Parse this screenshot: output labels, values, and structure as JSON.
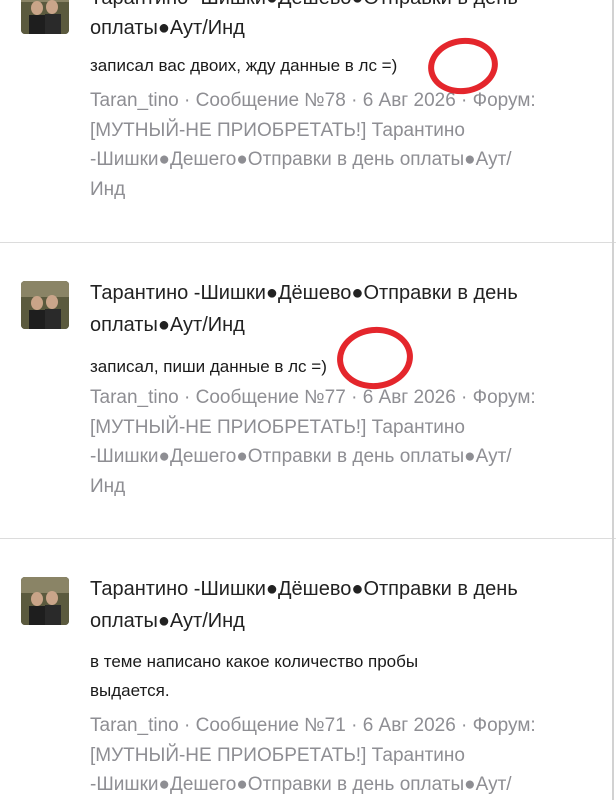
{
  "posts": [
    {
      "topic_line1": "Тарантино -Шишки●Дёшево●Отправки в день",
      "topic_line2": "оплаты●Аут/Инд",
      "message": "записал вас двоих, жду данные в лс =)",
      "meta_line1": "Taran_tino · Сообщение №78 · 6 Авг 2026 · Форум:",
      "meta_line2": "[МУТНЫЙ-НЕ ПРИОБРЕТАТЬ!] Тарантино",
      "meta_line3": "-Шишки●Дешего●Отправки в день оплаты●Аут/",
      "meta_line4": "Инд"
    },
    {
      "topic_line1": "Тарантино -Шишки●Дёшево●Отправки в день",
      "topic_line2": "оплаты●Аут/Инд",
      "message": "записал, пиши данные в лс =)",
      "meta_line1": "Taran_tino · Сообщение №77 · 6 Авг 2026 · Форум:",
      "meta_line2": "[МУТНЫЙ-НЕ ПРИОБРЕТАТЬ!] Тарантино",
      "meta_line3": "-Шишки●Дешего●Отправки в день оплаты●Аут/",
      "meta_line4": "Инд"
    },
    {
      "topic_line1": "Тарантино -Шишки●Дёшево●Отправки в день",
      "topic_line2": "оплаты●Аут/Инд",
      "message_line1": "в теме написано какое количество пробы",
      "message_line2": "выдается.",
      "meta_line1": "Taran_tino · Сообщение №71 · 6 Авг 2026 · Форум:",
      "meta_line2": "[МУТНЫЙ-НЕ ПРИОБРЕТАТЬ!] Тарантино",
      "meta_line3": "-Шишки●Дешего●Отправки в день оплаты●Аут/"
    }
  ],
  "colors": {
    "text": "#1a1a1a",
    "meta_gray": "#8e8e93",
    "annotation_red": "#e4262c",
    "divider": "#dcdcdc"
  },
  "icons": [
    "avatar-photo",
    "red-circle-annotation"
  ]
}
